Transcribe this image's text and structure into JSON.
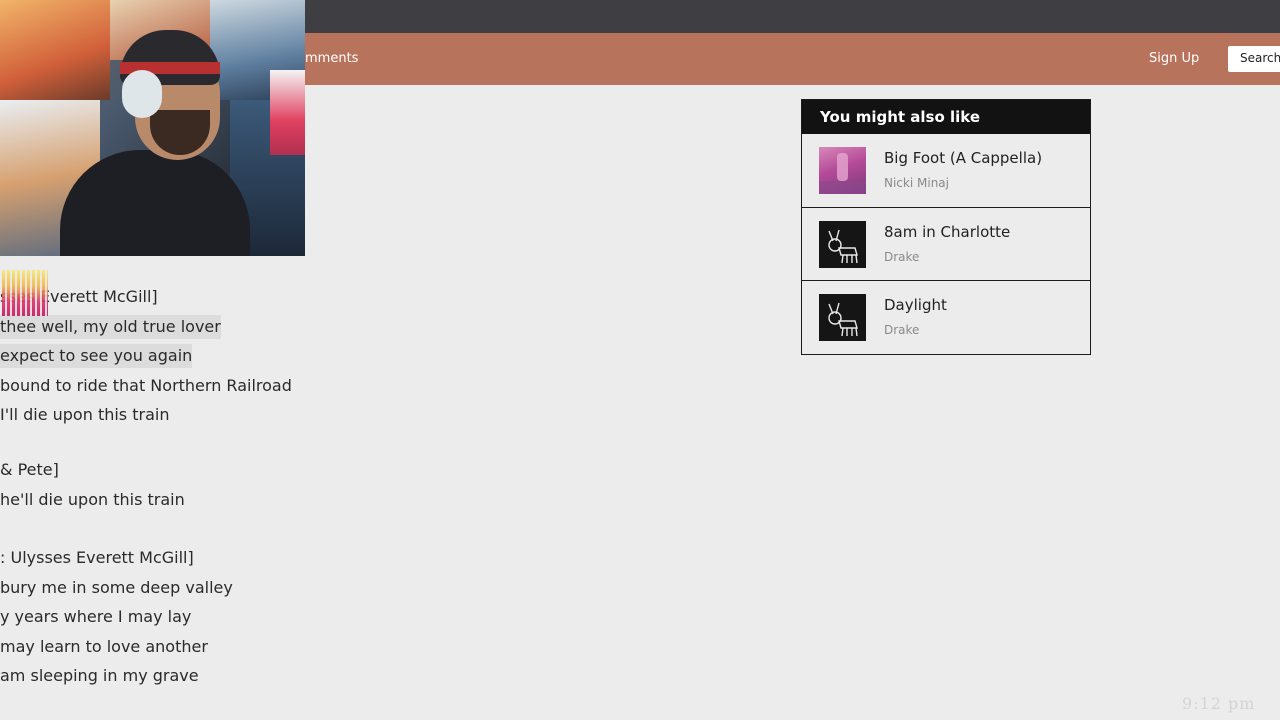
{
  "header": {
    "comments_label": "mments",
    "signup_label": "Sign Up",
    "search_label": "Search"
  },
  "lyrics": [
    "sses Everett McGill]",
    "thee well, my old true lover",
    "expect to see you again",
    "bound to ride that Northern Railroad",
    " I'll die upon this train",
    "& Pete]",
    " he'll die upon this train",
    ": Ulysses Everett McGill]",
    " bury me in some deep valley",
    "y years where I may lay",
    " may learn to love another",
    "am sleeping in my grave"
  ],
  "sidebar": {
    "title": "You might also like",
    "items": [
      {
        "title": "Big Foot (A Cappella)",
        "artist": "Nicki Minaj",
        "thumb": "pink-album-art"
      },
      {
        "title": "8am in Charlotte",
        "artist": "Drake",
        "thumb": "dog-drawing-album-art"
      },
      {
        "title": "Daylight",
        "artist": "Drake",
        "thumb": "dog-drawing-album-art"
      }
    ]
  },
  "watermark": "9:12 pm",
  "colors": {
    "topbar": "#3f3e42",
    "navbar": "#b8735c",
    "page_background": "#ececec",
    "sidebar_header": "#121212"
  }
}
